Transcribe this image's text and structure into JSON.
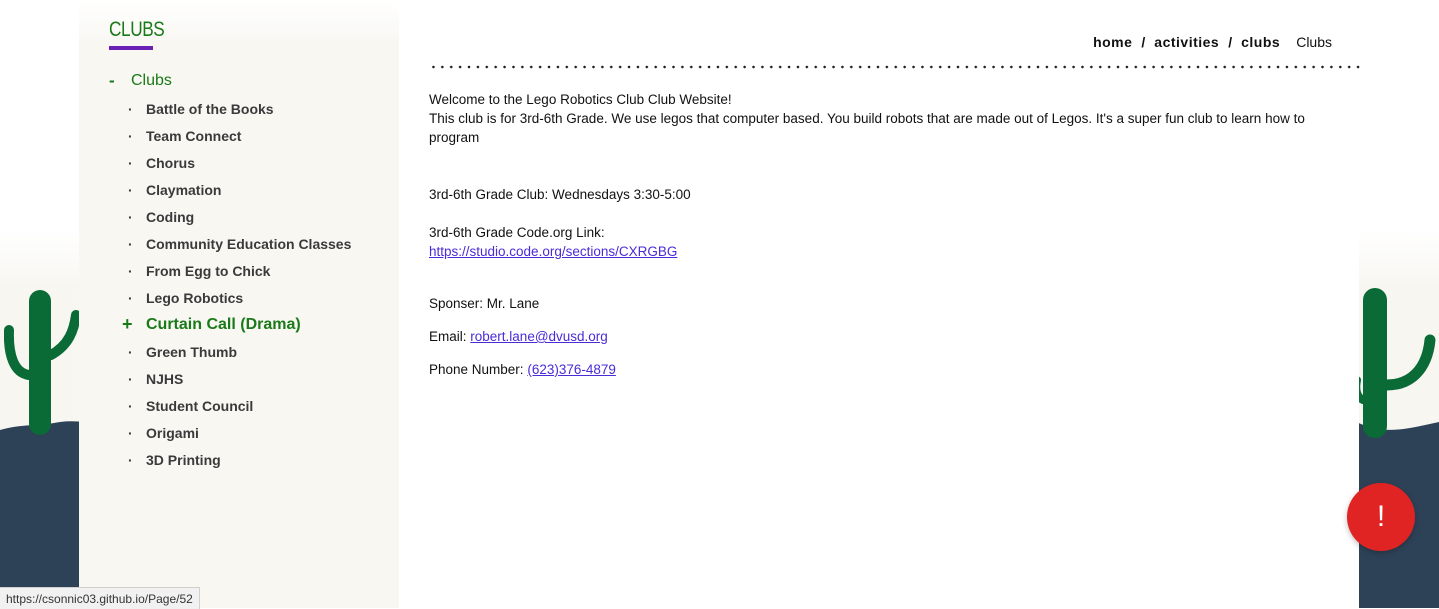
{
  "sidebar": {
    "heading": "CLUBS",
    "parent": {
      "toggle": "-",
      "label": "Clubs"
    },
    "items": [
      {
        "label": "Battle of the Books",
        "marker": "·"
      },
      {
        "label": "Team Connect",
        "marker": "·"
      },
      {
        "label": "Chorus",
        "marker": "·"
      },
      {
        "label": "Claymation",
        "marker": "·"
      },
      {
        "label": "Coding",
        "marker": "·"
      },
      {
        "label": "Community Education Classes",
        "marker": "·"
      },
      {
        "label": "From Egg to Chick",
        "marker": "·"
      },
      {
        "label": "Lego Robotics",
        "marker": "·"
      },
      {
        "label": "Curtain Call (Drama)",
        "marker": "+"
      },
      {
        "label": "Green Thumb",
        "marker": "·"
      },
      {
        "label": "NJHS",
        "marker": "·"
      },
      {
        "label": "Student Council",
        "marker": "·"
      },
      {
        "label": "Origami",
        "marker": "·"
      },
      {
        "label": "3D Printing",
        "marker": "·"
      }
    ]
  },
  "breadcrumb": {
    "items": [
      "home",
      "activities",
      "clubs"
    ],
    "separator": "/",
    "current": "Clubs"
  },
  "content": {
    "welcome": "Welcome to the Lego Robotics Club Club Website!",
    "description": "This club is for 3rd-6th Grade. We use legos that computer based. You build robots that are made out of Legos. It's a super fun club to learn how to program",
    "schedule": "3rd-6th Grade Club: Wednesdays 3:30-5:00",
    "code_link_label": "3rd-6th Grade Code.org Link:",
    "code_link": "https://studio.code.org/sections/CXRGBG",
    "sponsor": "Sponser: Mr. Lane",
    "email_label": "Email:",
    "email": "robert.lane@dvusd.org",
    "phone_label": "Phone Number:",
    "phone": "(623)376-4879"
  },
  "alert_button": {
    "symbol": "!"
  },
  "status_url": "https://csonnic03.github.io/Page/52",
  "colors": {
    "accent_green": "#1a7a1a",
    "underline_purple": "#6a1fb5",
    "ground": "#2e4257",
    "cactus": "#0a6b36",
    "alert_red": "#e02424",
    "link": "#4a2bd6"
  }
}
